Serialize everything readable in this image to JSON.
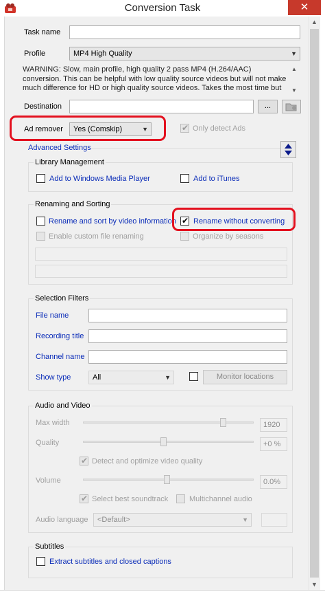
{
  "window": {
    "title": "Conversion Task",
    "close_glyph": "✕"
  },
  "task": {
    "name_label": "Task name",
    "name_value": ""
  },
  "profile": {
    "label": "Profile",
    "value": "MP4 High Quality",
    "description": "WARNING: Slow, main profile, high quality 2 pass MP4 (H.264/AAC) conversion. This can be helpful with low quality source videos but will not make much difference for HD or high quality source videos. Takes the most time but"
  },
  "destination": {
    "label": "Destination",
    "value": "",
    "browse_label": "..."
  },
  "ad_remover": {
    "label": "Ad remover",
    "value": "Yes (Comskip)",
    "only_detect_label": "Only detect Ads",
    "only_detect_checked": true
  },
  "advanced": {
    "link_label": "Advanced Settings"
  },
  "library": {
    "title": "Library Management",
    "wmp_label": "Add to Windows Media Player",
    "itunes_label": "Add to iTunes"
  },
  "renaming": {
    "title": "Renaming and Sorting",
    "rename_sort_label": "Rename and sort by video information",
    "rename_without_label": "Rename without converting",
    "rename_without_checked": true,
    "custom_label": "Enable custom file renaming",
    "seasons_label": "Organize by seasons"
  },
  "filters": {
    "title": "Selection Filters",
    "file_name_label": "File name",
    "recording_title_label": "Recording title",
    "channel_name_label": "Channel name",
    "show_type_label": "Show type",
    "show_type_value": "All",
    "monitor_label": "Monitor locations"
  },
  "audio_video": {
    "title": "Audio and Video",
    "max_width_label": "Max width",
    "max_width_value": "1920",
    "max_width_level": 0.82,
    "quality_label": "Quality",
    "quality_value": "+0 %",
    "quality_level": 0.47,
    "detect_label": "Detect and optimize video quality",
    "detect_checked": true,
    "volume_label": "Volume",
    "volume_value": "0.0%",
    "volume_level": 0.49,
    "soundtrack_label": "Select best soundtrack",
    "soundtrack_checked": true,
    "multichannel_label": "Multichannel audio",
    "audio_language_label": "Audio language",
    "audio_language_value": "<Default>"
  },
  "subtitles": {
    "title": "Subtitles",
    "extract_label": "Extract subtitles and closed captions"
  },
  "colors": {
    "highlight_ring": "#e3101e",
    "link_blue": "#0a2cb8",
    "close_red": "#c7392b"
  },
  "icons": [
    "app-icon",
    "close-icon",
    "folder-icon",
    "expand-collapse-icon",
    "chevron-down-icon",
    "checkmark-icon"
  ]
}
